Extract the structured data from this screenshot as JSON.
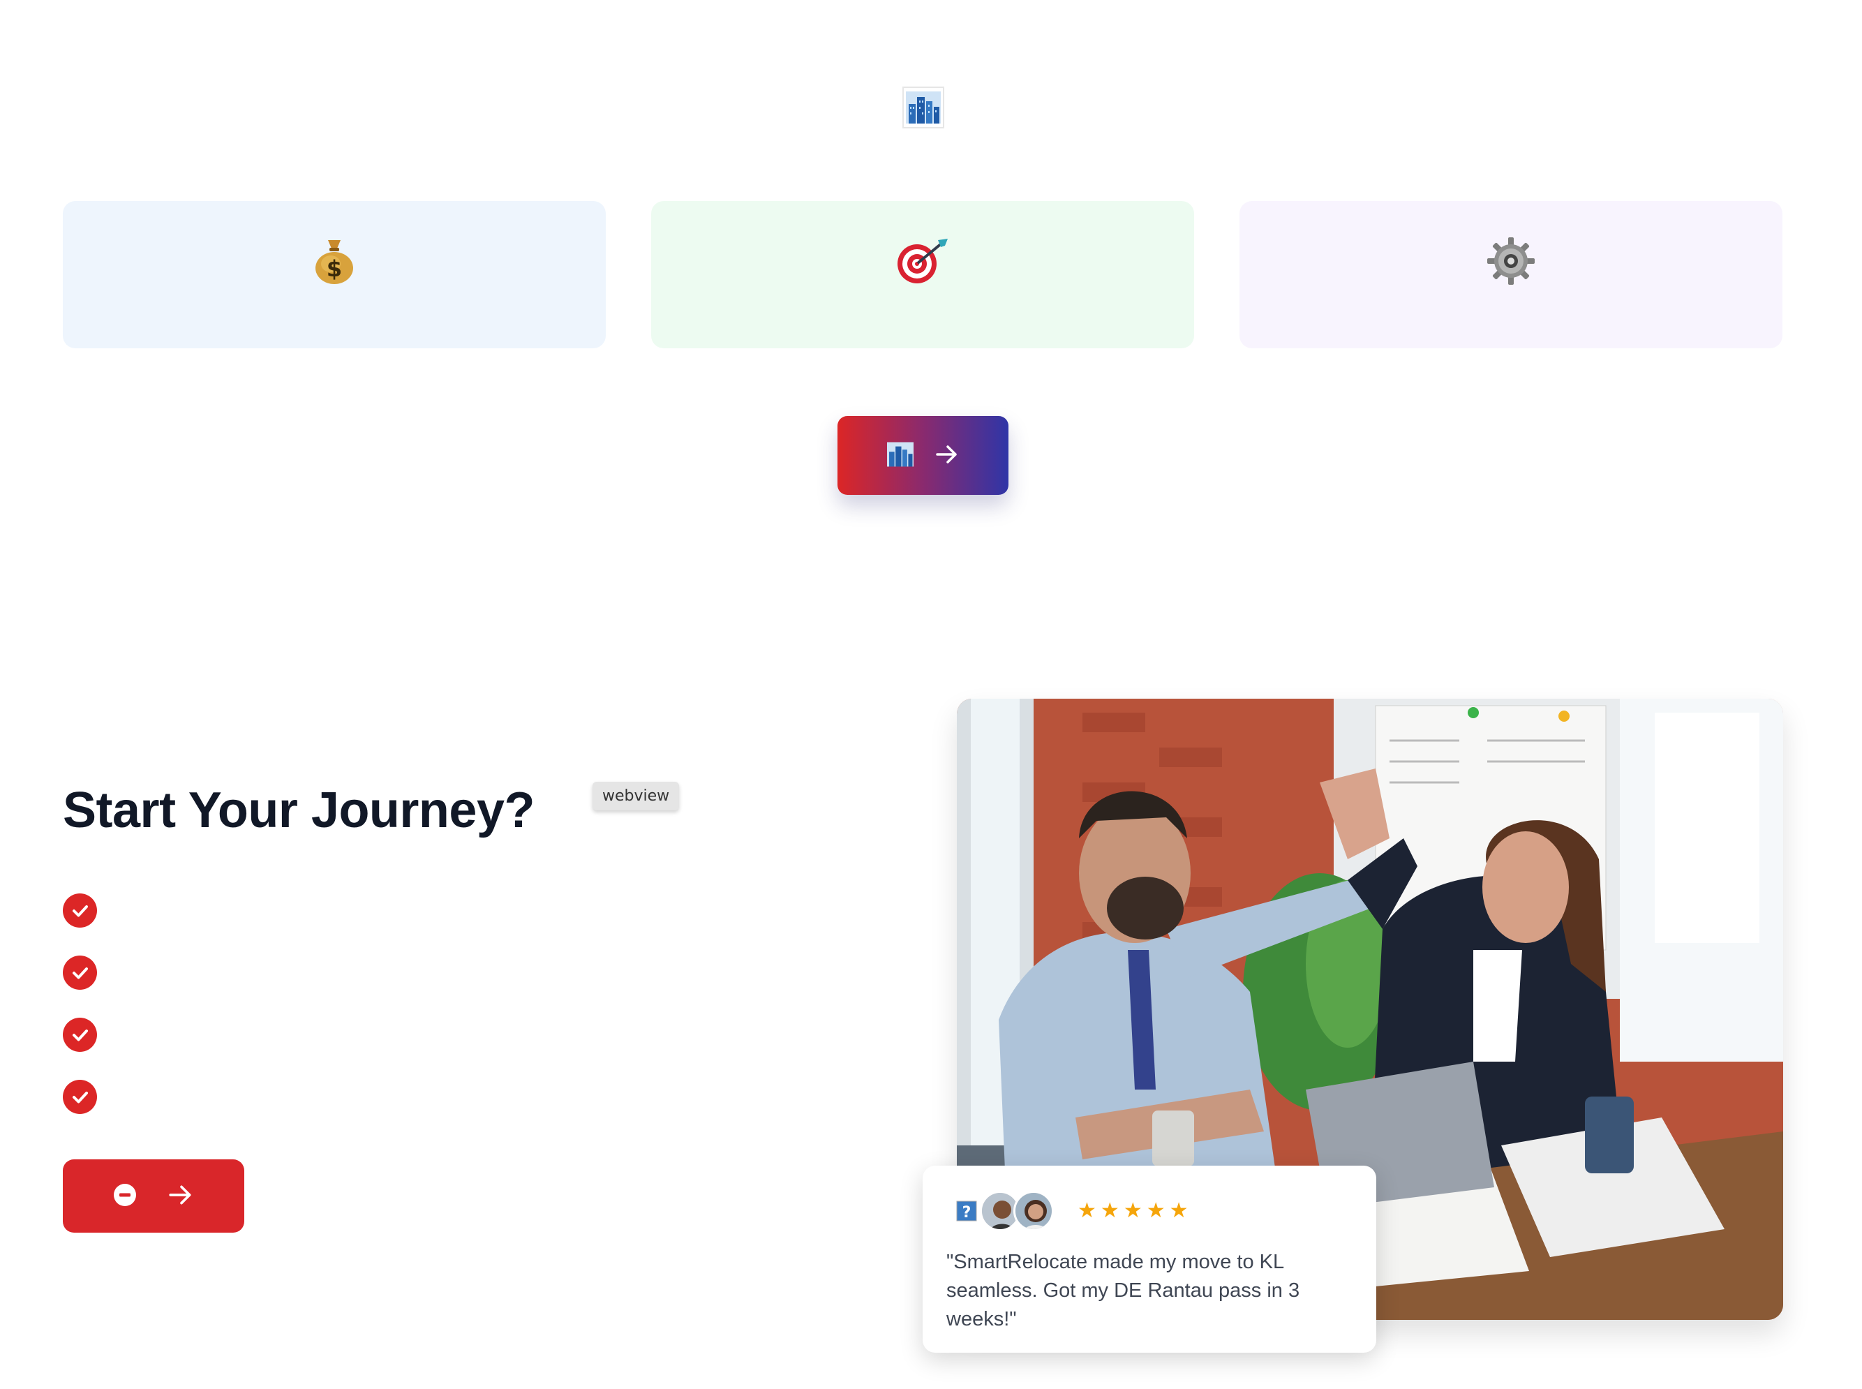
{
  "hero": {
    "icon": "cityscape-icon",
    "cards": [
      {
        "icon": "money-bag-icon"
      },
      {
        "icon": "target-icon"
      },
      {
        "icon": "gear-icon"
      }
    ],
    "cta": {
      "icons": [
        "cityscape-icon",
        "arrow-right-icon"
      ]
    }
  },
  "journey": {
    "title": "Start Your Journey?",
    "tooltip": "webview",
    "checklist_count": 4,
    "cta": {
      "icons": [
        "minus-circle-icon",
        "arrow-right-icon"
      ]
    }
  },
  "testimonial": {
    "rating": 5,
    "quote": "\"SmartRelocate made my move to KL seamless. Got my DE Rantau pass in 3 weeks!\""
  },
  "colors": {
    "brand_red": "#dc2626",
    "brand_blue": "#2f35a7",
    "star": "#f5a50b",
    "text_dark": "#111827"
  }
}
